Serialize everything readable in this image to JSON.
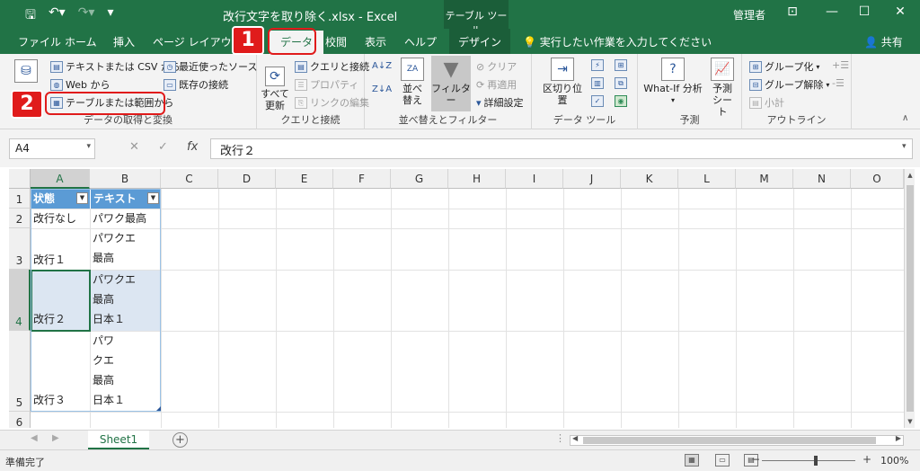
{
  "app": {
    "title": "改行文字を取り除く.xlsx  -  Excel",
    "context_tab_title": "テーブル ツール",
    "user": "管理者"
  },
  "tabs": {
    "file": "ファイル",
    "home": "ホーム",
    "insert": "挿入",
    "layout": "ページ レイアウト",
    "data": "データ",
    "review": "校閲",
    "view": "表示",
    "help": "ヘルプ",
    "design": "デザイン",
    "tell_me": "実行したい作業を入力してください",
    "share": "共有"
  },
  "ribbon": {
    "get_data": {
      "from_csv": "テキストまたは CSV から",
      "from_web": "Web から",
      "from_table": "テーブルまたは範囲から",
      "recent": "最近使ったソース",
      "existing": "既存の接続",
      "group_label": "データの取得と変換"
    },
    "queries": {
      "refresh_line1": "すべて",
      "refresh_line2": "更新",
      "queries_connections": "クエリと接続",
      "properties": "プロパティ",
      "edit_links": "リンクの編集",
      "group_label": "クエリと接続"
    },
    "sort_filter": {
      "sort": "並べ替え",
      "filter": "フィルター",
      "clear": "クリア",
      "reapply": "再適用",
      "advanced": "詳細設定",
      "group_label": "並べ替えとフィルター"
    },
    "data_tools": {
      "text_to_columns": "区切り位置",
      "group_label": "データ ツール"
    },
    "forecast": {
      "whatif": "What-If 分析",
      "forecast_line1": "予測",
      "forecast_line2": "シート",
      "group_label": "予測"
    },
    "outline": {
      "group": "グループ化",
      "ungroup": "グループ解除",
      "subtotal": "小計",
      "group_label": "アウトライン"
    }
  },
  "formula_bar": {
    "name_box": "A4",
    "formula": "改行２",
    "fx": "fx"
  },
  "grid": {
    "columns": [
      "A",
      "B",
      "C",
      "D",
      "E",
      "F",
      "G",
      "H",
      "I",
      "J",
      "K",
      "L",
      "M",
      "N",
      "O"
    ],
    "rows": [
      "1",
      "2",
      "3",
      "4",
      "5",
      "6"
    ],
    "header": [
      "状態",
      "テキスト"
    ],
    "cells": {
      "a2": "改行なし",
      "b2": "パワク最高",
      "a3": "改行１",
      "b3": [
        "パワクエ",
        "最高"
      ],
      "a4": "改行２",
      "b4": [
        "パワクエ",
        "最高",
        "日本１"
      ],
      "a5": "改行３",
      "b5": [
        "パワ",
        "クエ",
        "最高",
        "日本１"
      ]
    }
  },
  "sheets": {
    "active": "Sheet1"
  },
  "status": {
    "ready": "準備完了",
    "zoom": "100%"
  },
  "callouts": {
    "step1": "1",
    "step2": "2"
  },
  "colors": {
    "excel_green": "#217346",
    "table_header": "#5b9bd5",
    "callout_red": "#e01b1b"
  }
}
